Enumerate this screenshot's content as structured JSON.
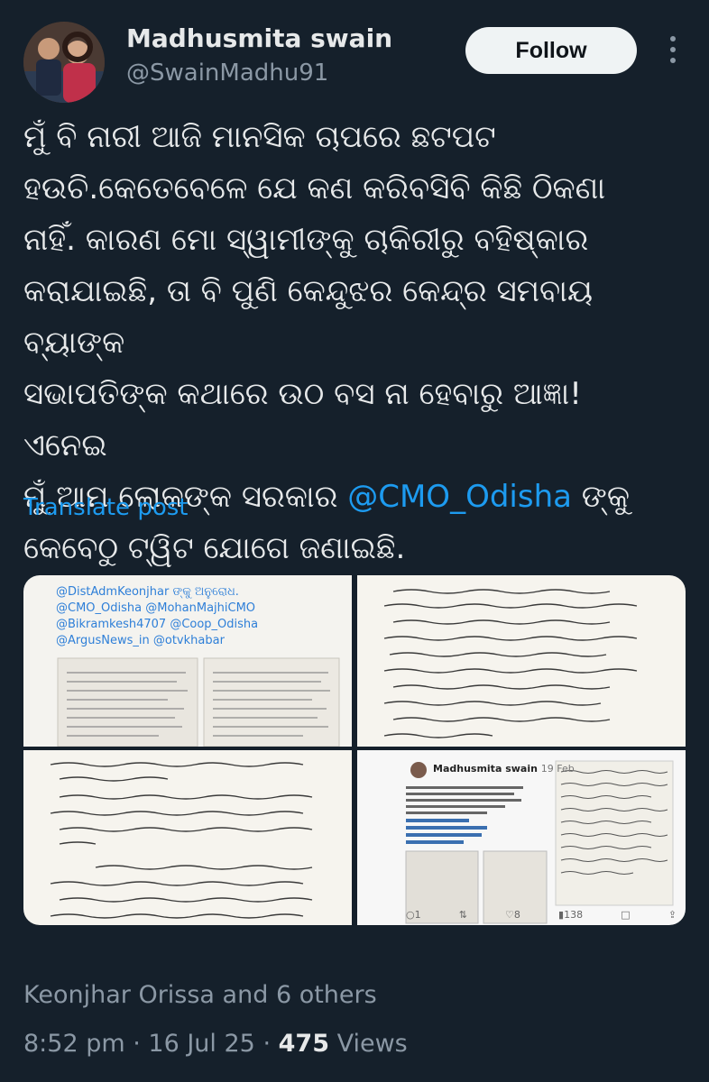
{
  "author": {
    "name": "Madhusmita swain",
    "handle": "@SwainMadhu91"
  },
  "follow_label": "Follow",
  "tweet": {
    "text_before": "ମୁଁ ବି ନାରୀ ଆଜି ମାନସିକ ଚାପରେ ଛଟପଟ\nହଉଚି.କେତେବେଳେ ଯେ କଣ କରିବସିବି କିଛି ଠିକଣା\nନାହିଁ. କାରଣ ମୋ ସ୍ୱାମୀଙ୍କୁ ଚାକିରୀରୁ ବହିଷ୍କାର\nକରାଯାଇଛି, ତା ବି ପୁଣି କେନ୍ଦୁଝର କେନ୍ଦ୍ର ସମବାୟ ବ୍ୟାଙ୍କ\nସଭାପତିଙ୍କ କଥାରେ ଉଠ ବସ ନା ହେବାରୁ ଆଜ୍ଞା! ଏନେଇ\nମୁଁ ଆମ ଲୋକଙ୍କ ସରକାର ",
    "mention": "@CMO_Odisha",
    "text_after": " ଙ୍କୁ\nକେବେଠୁ ଟ୍ୱିଟ ଯୋଗେ ଜଣାଇଛି."
  },
  "translate_label": "Translate post",
  "media": {
    "image1_lines": [
      "@DistAdmKeonjhar ଙ୍କୁ ଅନୁରୋଧ.",
      "@CMO_Odisha @MohanMajhiCMO",
      "@Bikramkesh4707 @Coop_Odisha",
      "@ArgusNews_in @otvkhabar"
    ],
    "image4": {
      "name": "Madhusmita swain",
      "date": "19 Feb",
      "replies": "1",
      "likes": "8",
      "views": "138"
    }
  },
  "location_line": "Keonjhar Orissa and 6 others",
  "meta": {
    "time": "8:52 pm",
    "sep1": " · ",
    "date": "16 Jul 25",
    "sep2": " · ",
    "views": "475",
    "views_label": " Views"
  }
}
